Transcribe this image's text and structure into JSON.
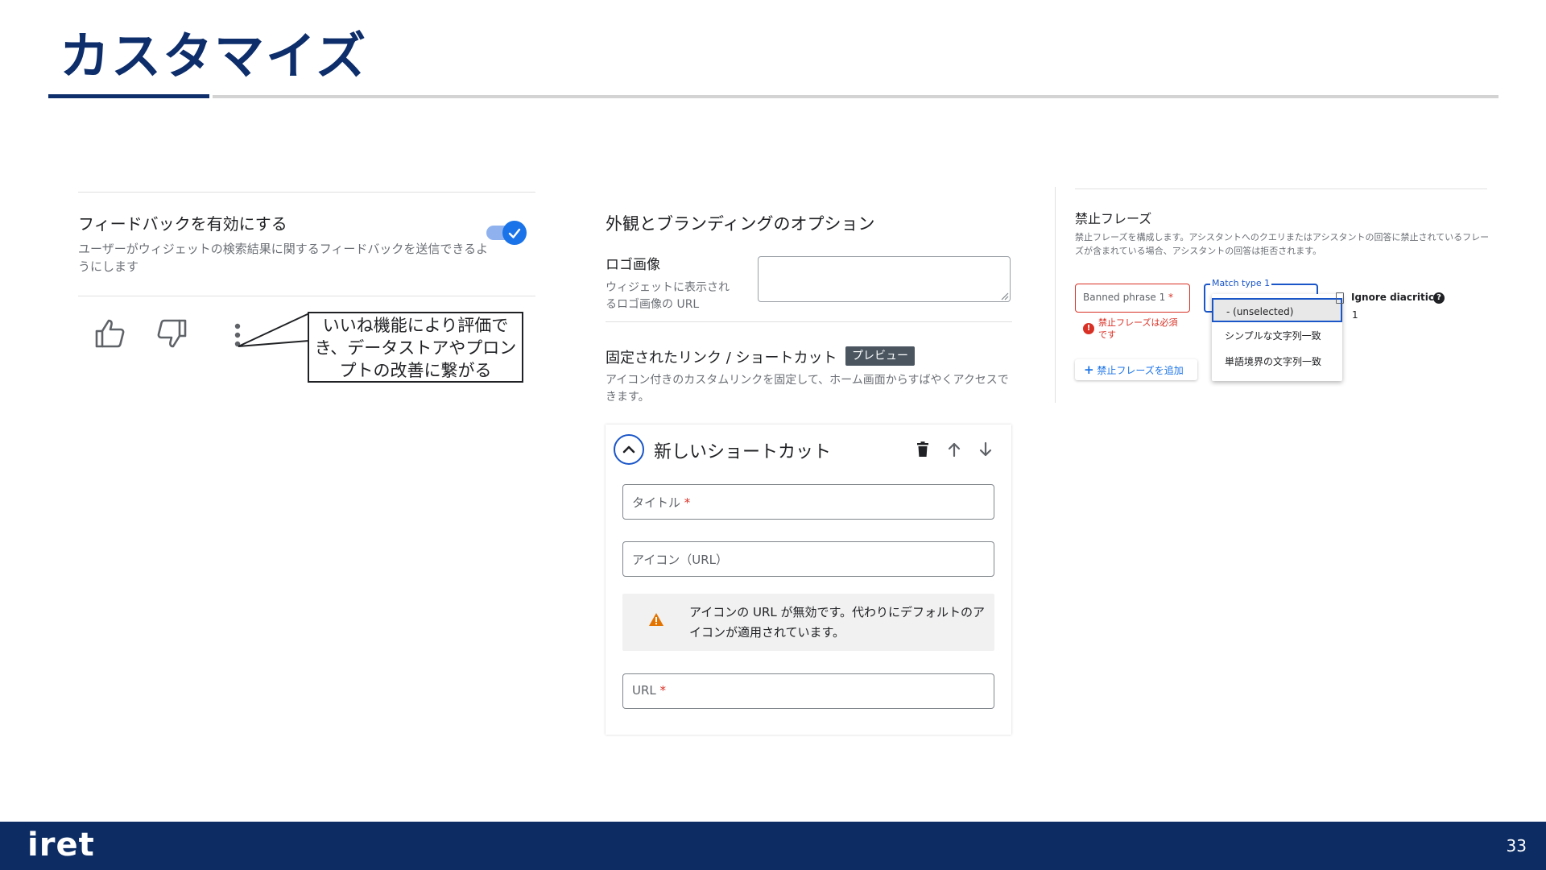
{
  "slide": {
    "title": "カスタマイズ",
    "logo": "iret",
    "page_number": "33"
  },
  "feedback_panel": {
    "heading": "フィードバックを有効にする",
    "description": "ユーザーがウィジェットの検索結果に関するフィードバックを送信できるようにします",
    "toggle_enabled": true,
    "icons": [
      "thumbs-up-icon",
      "thumbs-down-icon",
      "more-vert-icon"
    ],
    "callout_text": "いいね機能により評価でき、データストアやプロンプトの改善に繋がる"
  },
  "appearance_panel": {
    "heading": "外観とブランディングのオプション",
    "logo_label": "ロゴ画像",
    "logo_description": "ウィジェットに表示されるロゴ画像の URL",
    "logo_value": "",
    "pinned_heading": "固定されたリンク / ショートカット",
    "preview_badge": "プレビュー",
    "pinned_description": "アイコン付きのカスタムリンクを固定して、ホーム画面からすばやくアクセスできます。",
    "shortcut": {
      "title": "新しいショートカット",
      "fields": [
        {
          "label": "タイトル",
          "required": "*"
        },
        {
          "label": "アイコン（URL）",
          "required": ""
        },
        {
          "label": "URL",
          "required": "*"
        }
      ],
      "warning": "アイコンの URL が無効です。代わりにデフォルトのアイコンが適用されています。"
    }
  },
  "banned_panel": {
    "heading": "禁止フレーズ",
    "description": "禁止フレーズを構成します。アシスタントへのクエリまたはアシスタントの回答に禁止されているフレーズが含まれている場合、アシスタントの回答は拒否されます。",
    "phrase_label": "Banned phrase 1",
    "phrase_required": "*",
    "error_text": "禁止フレーズは必須です",
    "add_button": "禁止フレーズを追加",
    "match_label": "Match type 1",
    "match_options": [
      "- (unselected)",
      "シンプルな文字列一致",
      "単語境界の文字列一致"
    ],
    "ignore_label": "Ignore diacritics",
    "ignore_value": "1"
  },
  "colors": {
    "brand_navy": "#0c2c63",
    "accent_blue": "#1a73e8",
    "error_red": "#d93025",
    "warning_orange": "#e37400"
  }
}
